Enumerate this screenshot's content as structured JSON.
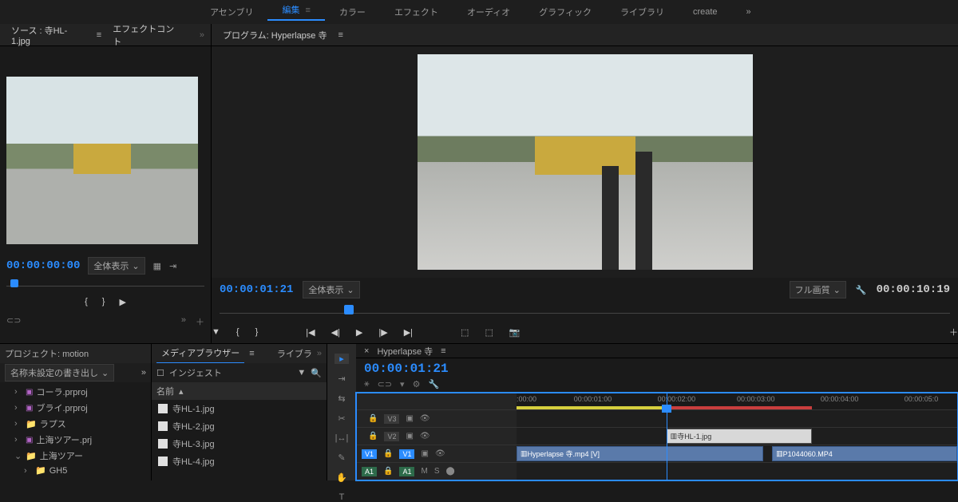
{
  "topTabs": {
    "assembly": "アセンブリ",
    "edit": "編集",
    "color": "カラー",
    "effects": "エフェクト",
    "audio": "オーディオ",
    "graphics": "グラフィック",
    "library": "ライブラリ",
    "create": "create"
  },
  "sourcePanel": {
    "title": "ソース : 寺HL-1.jpg",
    "effectTab": "エフェクトコント",
    "timecode": "00:00:00:00",
    "zoom": "全体表示"
  },
  "programPanel": {
    "title": "プログラム: Hyperlapse 寺",
    "timecode": "00:00:01:21",
    "zoom": "全体表示",
    "quality": "フル画質",
    "duration": "00:00:10:19"
  },
  "projectPanel": {
    "tab1": "プロジェクト: motion",
    "tab2": "メディアブラウザー",
    "tab3": "ライブラ",
    "export": "名称未設定の書き出し",
    "ingest": "インジェスト",
    "tree": {
      "item1": "コーラ.prproj",
      "item2": "ブライ.prproj",
      "item3": "ラプス",
      "item4": "上海ツアー.prj",
      "item5": "上海ツアー",
      "item6": "GH5"
    }
  },
  "mediaPanel": {
    "nameHeader": "名前",
    "files": {
      "f1": "寺HL-1.jpg",
      "f2": "寺HL-2.jpg",
      "f3": "寺HL-3.jpg",
      "f4": "寺HL-4.jpg"
    }
  },
  "timeline": {
    "title": "Hyperlapse 寺",
    "timecode": "00:00:01:21",
    "ticks": {
      "t0": ":00:00",
      "t1": "00:00:01:00",
      "t2": "00:00:02:00",
      "t3": "00:00:03:00",
      "t4": "00:00:04:00",
      "t5": "00:00:05:0"
    },
    "tracks": {
      "v3": "V3",
      "v2": "V2",
      "v1": "V1",
      "a1": "A1",
      "m": "M",
      "s": "S"
    },
    "clips": {
      "c1": "Hyperlapse 寺.mp4 [V]",
      "c2": "寺HL-1.jpg",
      "c3": "P1044060.MP4"
    }
  }
}
